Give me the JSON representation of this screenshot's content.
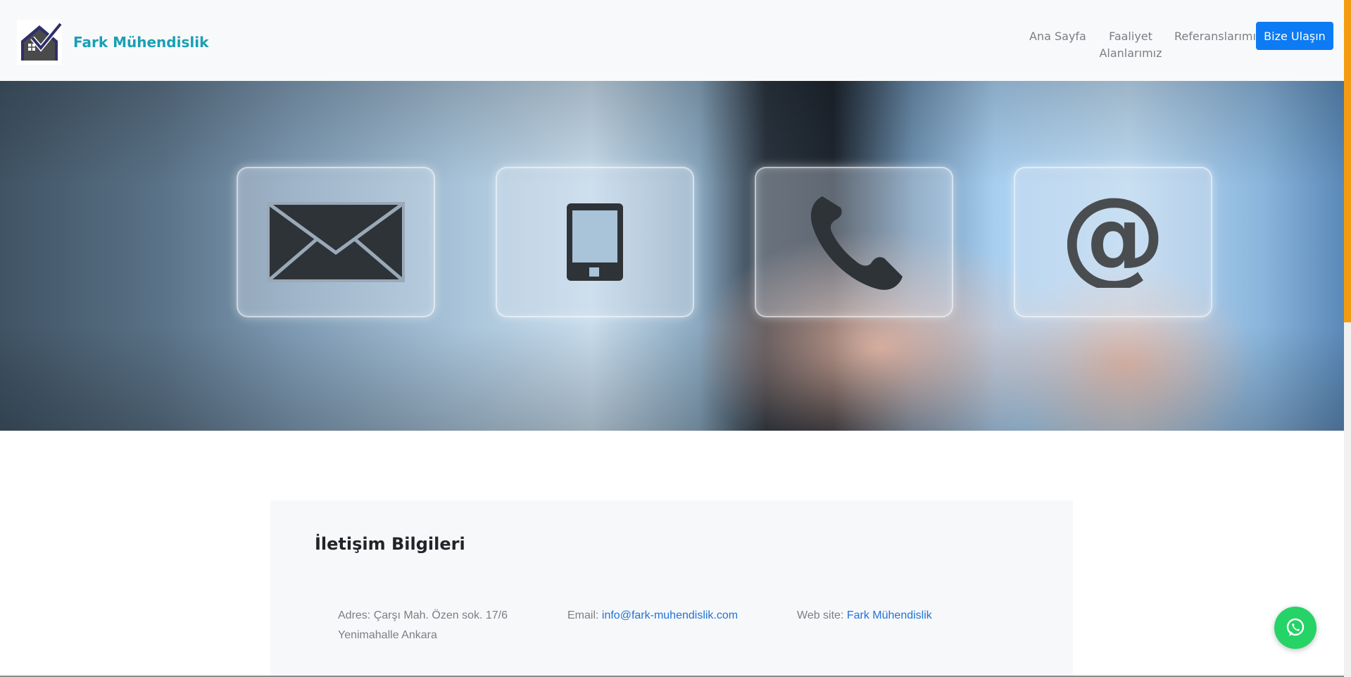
{
  "header": {
    "brand_name": "Fark Mühendislik",
    "logo_icon": "house-check-logo",
    "nav": {
      "home": "Ana Sayfa",
      "faaliyet": "Faaliyet Alanlarımız",
      "references": "Referanslarımız",
      "contact_button": "Bize Ulaşın"
    }
  },
  "hero": {
    "icons": [
      "envelope-icon",
      "mobile-phone-icon",
      "telephone-icon",
      "at-sign-icon"
    ]
  },
  "contact_info": {
    "title": "İletişim Bilgileri",
    "address_label": "Adres:",
    "address_value": "Çarşı Mah. Özen sok. 17/6 Yenimahalle Ankara",
    "email_label": "Email:",
    "email_value": "info@fark-muhendislik.com",
    "web_label": "Web site:",
    "web_value": "Fark Mühendislik"
  },
  "floating": {
    "whatsapp_icon": "whatsapp-icon"
  },
  "colors": {
    "brand": "#1a9fb4",
    "primary_button": "#0d7bf3",
    "link": "#1e73d8",
    "whatsapp": "#25d366",
    "scrollbar": "#f39c12"
  }
}
